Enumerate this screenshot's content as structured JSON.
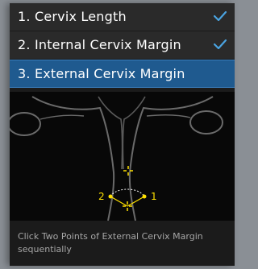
{
  "steps": [
    {
      "label": "1. Cervix Length",
      "completed": true
    },
    {
      "label": "2. Internal Cervix Margin",
      "completed": true
    },
    {
      "label": "3. External Cervix Margin",
      "completed": false
    }
  ],
  "diagram": {
    "point_labels": [
      "2",
      "1"
    ],
    "marker_color": "#ffe100"
  },
  "instruction": "Click Two Points of External Cervix Margin sequentially",
  "colors": {
    "active_step": "#1f5a8f",
    "check": "#4aa3e0"
  }
}
